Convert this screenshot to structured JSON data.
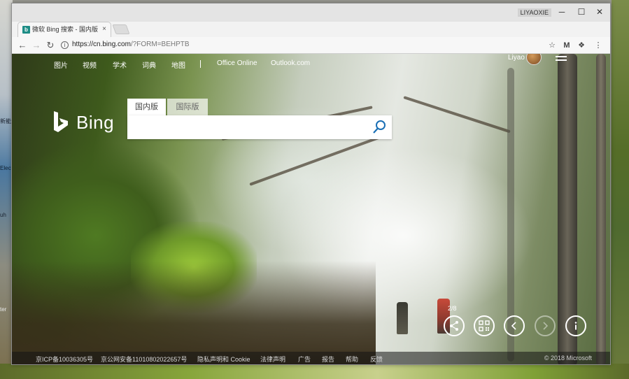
{
  "desktop": {
    "icon_labels": [
      "新能源",
      "Elect",
      "uh",
      "ter"
    ]
  },
  "window": {
    "profile_name": "LIYAOXIE",
    "controls": {
      "minimize": "─",
      "maximize": "☐",
      "close": "✕"
    }
  },
  "tab": {
    "favicon": "b",
    "title": "微软 Bing 搜索 - 国内版",
    "close": "×"
  },
  "toolbar": {
    "back": "←",
    "forward": "→",
    "reload": "↻",
    "url_host": "https://cn.bing.com",
    "url_rest": "/?FORM=BEHPTB",
    "star": "☆",
    "ext1": "M",
    "ext2": "❖",
    "menu": "⋮"
  },
  "page": {
    "nav": [
      "图片",
      "视频",
      "学术",
      "词典",
      "地图",
      "Office Online",
      "Outlook.com"
    ],
    "user_name": "Liyao",
    "logo_text": "Bing",
    "search_tabs": [
      "国内版",
      "国际版"
    ],
    "search": {
      "value": "",
      "placeholder": ""
    },
    "image_counter": "2/8",
    "footer_links": [
      "京ICP备10036305号",
      "京公网安备11010802022657号",
      "隐私声明和 Cookie",
      "法律声明",
      "广告",
      "报告",
      "帮助",
      "反馈"
    ],
    "copyright": "© 2018 Microsoft"
  },
  "colors": {
    "bing_teal": "#1e8d86",
    "search_icon": "#1a6fb5",
    "footer_bg": "#141414"
  }
}
